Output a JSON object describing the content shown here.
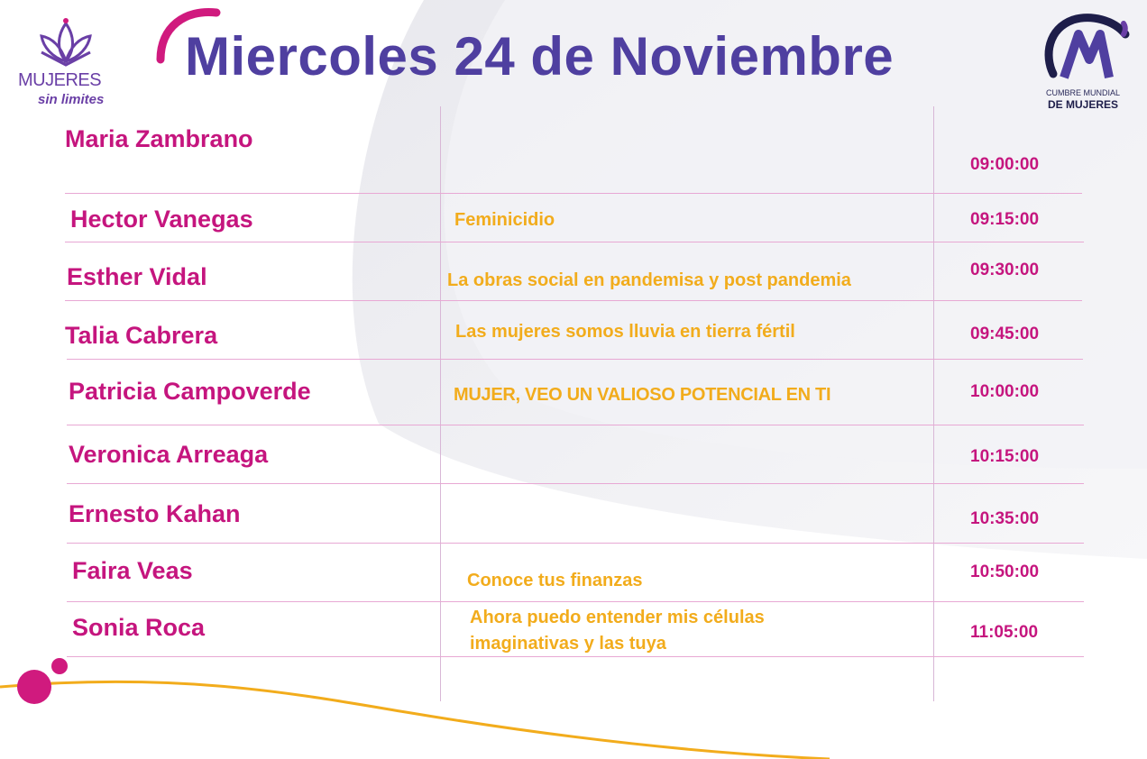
{
  "title": "Miercoles 24 de Noviembre",
  "logo_left": {
    "line1": "MUJERES",
    "line2": "sin limites"
  },
  "logo_right": {
    "letter": "M",
    "line1": "CUMBRE MUNDIAL",
    "line2": "DE MUJERES"
  },
  "colors": {
    "title": "#4f3fa0",
    "name": "#c5157e",
    "topic": "#f2ac1c",
    "time": "#c5157e",
    "accent_dot": "#d01a7e"
  },
  "schedule": [
    {
      "name": "Maria Zambrano",
      "topic": "",
      "time": "09:00:00"
    },
    {
      "name": "Hector Vanegas",
      "topic": "Feminicidio",
      "time": "09:15:00"
    },
    {
      "name": "Esther Vidal",
      "topic": "La obras social en pandemisa y post pandemia",
      "time": "09:30:00"
    },
    {
      "name": "Talia Cabrera",
      "topic": "Las mujeres somos lluvia en tierra fértil",
      "time": "09:45:00"
    },
    {
      "name": "Patricia Campoverde",
      "topic": "MUJER, VEO UN VALIOSO POTENCIAL EN TI",
      "time": "10:00:00"
    },
    {
      "name": "Veronica Arreaga",
      "topic": "",
      "time": "10:15:00"
    },
    {
      "name": "Ernesto Kahan",
      "topic": "",
      "time": "10:35:00"
    },
    {
      "name": "Faira Veas",
      "topic": "Conoce tus finanzas",
      "time": "10:50:00"
    },
    {
      "name": "Sonia Roca",
      "topic": "Ahora puedo entender mis células",
      "topic_line2": "imaginativas y las tuya",
      "time": "11:05:00"
    }
  ]
}
